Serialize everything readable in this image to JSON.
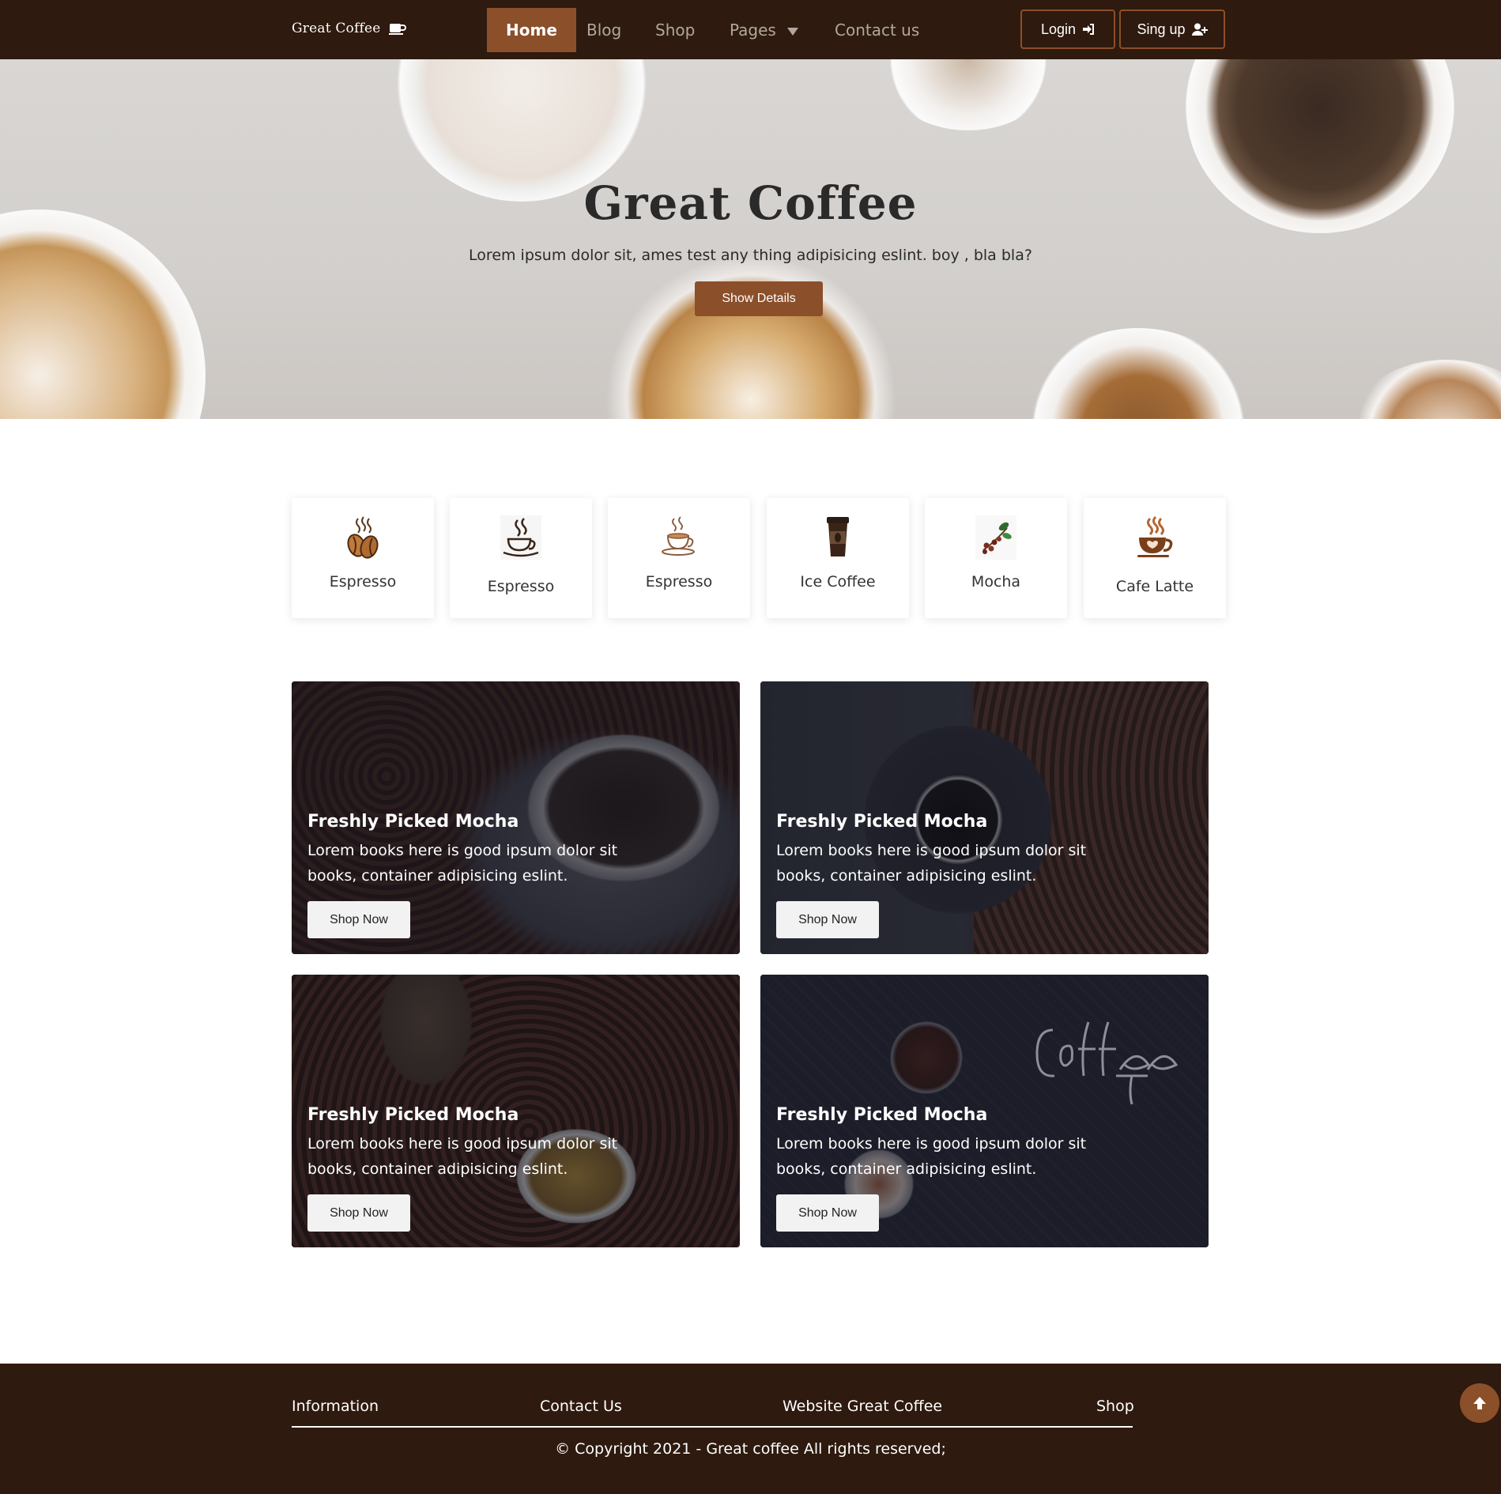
{
  "navbar": {
    "brand": "Great Coffee",
    "links": [
      {
        "label": "Home",
        "active": true
      },
      {
        "label": "Blog"
      },
      {
        "label": "Shop"
      },
      {
        "label": "Pages"
      },
      {
        "label": "Contact us"
      }
    ],
    "login_label": "Login",
    "signup_label": "Sing up"
  },
  "hero": {
    "title": "Great Coffee",
    "subtitle": "Lorem ipsum dolor sit, ames test any thing adipisicing eslint. boy , bla bla?",
    "button_label": "Show Details"
  },
  "categories": [
    {
      "label": "Espresso",
      "icon": "coffee-beans-icon"
    },
    {
      "label": "Espresso",
      "icon": "steaming-cup-icon"
    },
    {
      "label": "Espresso",
      "icon": "cup-saucer-icon"
    },
    {
      "label": "Ice Coffee",
      "icon": "takeaway-cup-icon"
    },
    {
      "label": "Mocha",
      "icon": "coffee-branch-icon"
    },
    {
      "label": "Cafe Latte",
      "icon": "latte-cup-icon"
    }
  ],
  "promos": [
    {
      "title": "Freshly Picked Mocha",
      "text": "Lorem books here is good ipsum dolor sit books, container adipisicing eslint.",
      "button_label": "Shop Now"
    },
    {
      "title": "Freshly Picked Mocha",
      "text": "Lorem books here is good ipsum dolor sit books, container adipisicing eslint.",
      "button_label": "Shop Now"
    },
    {
      "title": "Freshly Picked Mocha",
      "text": "Lorem books here is good ipsum dolor sit books, container adipisicing eslint.",
      "button_label": "Shop Now"
    },
    {
      "title": "Freshly Picked Mocha",
      "text": "Lorem books here is good ipsum dolor sit books, container adipisicing eslint.",
      "button_label": "Shop Now"
    }
  ],
  "footer": {
    "links": [
      "Information",
      "Contact Us",
      "Website Great Coffee",
      "Shop"
    ],
    "copyright": "© Copyright 2021 - Great coffee All rights reserved;"
  },
  "colors": {
    "nav_bg": "#2e1a0e",
    "accent": "#8b4f2a",
    "footer_bg": "#2e1a0e"
  }
}
